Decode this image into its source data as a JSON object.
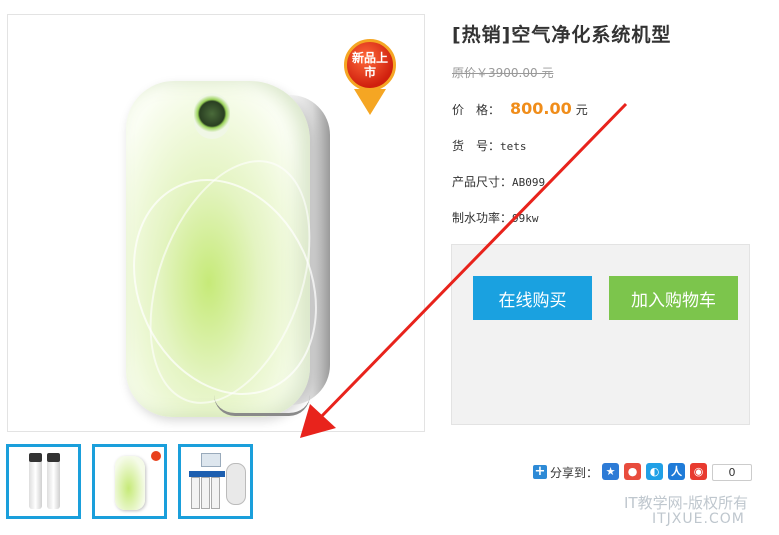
{
  "product": {
    "title": "[热销]空气净化系统机型",
    "original_price": "原价￥3900.00 元",
    "price_label": "价　格：",
    "price_value": "800.00",
    "price_unit": "元",
    "sku_label": "货　号：",
    "sku_value": "tets",
    "size_label": "产品尺寸：",
    "size_value": "AB099",
    "power_label": "制水功率：",
    "power_value": "99kw"
  },
  "badge_text": "新品上市",
  "buttons": {
    "buy_now": "在线购买",
    "add_to_cart": "加入购物车"
  },
  "share": {
    "label": "分享到：",
    "icons": [
      "qzone-icon",
      "weibo-icon",
      "tencent-icon",
      "renren-icon",
      "kaixin-icon"
    ],
    "count": "0"
  },
  "thumbnails": [
    "twin-filter-thumbnail",
    "purifier-thumbnail",
    "ro-system-thumbnail"
  ],
  "watermark": {
    "line1": "IT教学网-版权所有",
    "line2": "ITJXUE.COM"
  },
  "colors": {
    "buy_button": "#1aa1e0",
    "cart_button": "#7cc54c",
    "price": "#f08d1a",
    "thumb_border": "#1a9fdb",
    "arrow": "#e8231c"
  }
}
